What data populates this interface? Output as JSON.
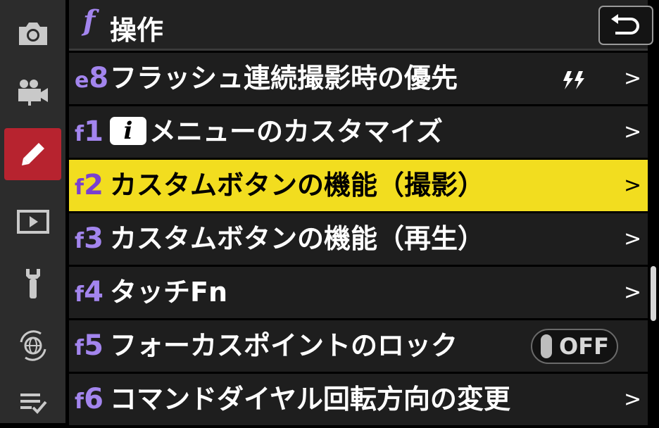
{
  "sidebar": {
    "items": [
      {
        "icon": "camera-icon",
        "active": false
      },
      {
        "icon": "video-camera-icon",
        "active": false
      },
      {
        "icon": "pencil-icon",
        "active": true
      },
      {
        "icon": "playback-icon",
        "active": false
      },
      {
        "icon": "wrench-icon",
        "active": false
      },
      {
        "icon": "network-globe-icon",
        "active": false
      },
      {
        "icon": "my-menu-icon",
        "active": false
      }
    ]
  },
  "header": {
    "letter": "f",
    "title": "操作",
    "back_icon": "return-icon"
  },
  "menu": {
    "items": [
      {
        "code_letter": "e",
        "code_number": "8",
        "label": "フラッシュ連続撮影時の優先",
        "value_icon": "flash-priority-icon"
      },
      {
        "code_letter": "f",
        "code_number": "1",
        "badge": "i",
        "label": "メニューのカスタマイズ"
      },
      {
        "code_letter": "f",
        "code_number": "2",
        "label": "カスタムボタンの機能（撮影）",
        "selected": true
      },
      {
        "code_letter": "f",
        "code_number": "3",
        "label": "カスタムボタンの機能（再生）"
      },
      {
        "code_letter": "f",
        "code_number": "4",
        "label": "タッチFn"
      },
      {
        "code_letter": "f",
        "code_number": "5",
        "label": "フォーカスポイントのロック",
        "toggle": "OFF"
      },
      {
        "code_letter": "f",
        "code_number": "6",
        "label": "コマンドダイヤル回転方向の変更"
      }
    ],
    "chevron": ">"
  },
  "colors": {
    "accent_purple": "#a385ee",
    "highlight_yellow": "#f2dd1f",
    "active_red": "#b7232f"
  }
}
